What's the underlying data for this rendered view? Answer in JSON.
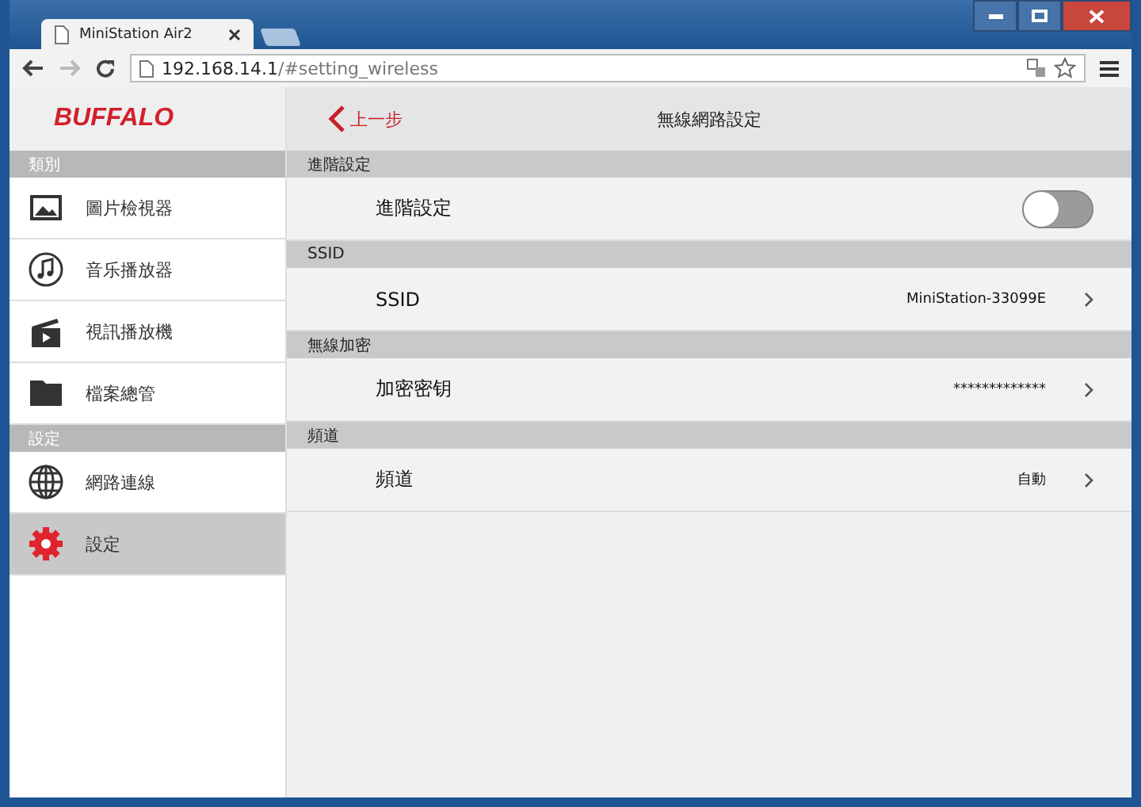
{
  "browser": {
    "tab_title": "MiniStation Air2",
    "url_host": "192.168.14.1",
    "url_path": "/#setting_wireless"
  },
  "sidebar": {
    "logo": "BUFFALO",
    "groups": [
      {
        "heading": "類別",
        "items": [
          {
            "label": "圖片檢視器",
            "kind": "image",
            "selected": false
          },
          {
            "label": "音乐播放器",
            "kind": "music",
            "selected": false
          },
          {
            "label": "視訊播放機",
            "kind": "video",
            "selected": false
          },
          {
            "label": "檔案總管",
            "kind": "folder",
            "selected": false
          }
        ]
      },
      {
        "heading": "設定",
        "items": [
          {
            "label": "網路連線",
            "kind": "globe",
            "selected": false
          },
          {
            "label": "設定",
            "kind": "gear",
            "selected": true
          }
        ]
      }
    ]
  },
  "header": {
    "back": "上一步",
    "title": "無線網路設定"
  },
  "sections": [
    {
      "heading": "進階設定",
      "row": {
        "label": "進階設定",
        "kind": "toggle",
        "on": false
      }
    },
    {
      "heading": "SSID",
      "row": {
        "label": "SSID",
        "kind": "link",
        "value": "MiniStation-33099E"
      }
    },
    {
      "heading": "無線加密",
      "row": {
        "label": "加密密钥",
        "kind": "link",
        "value": "*************"
      }
    },
    {
      "heading": "頻道",
      "row": {
        "label": "頻道",
        "kind": "link",
        "value": "自動"
      }
    }
  ]
}
